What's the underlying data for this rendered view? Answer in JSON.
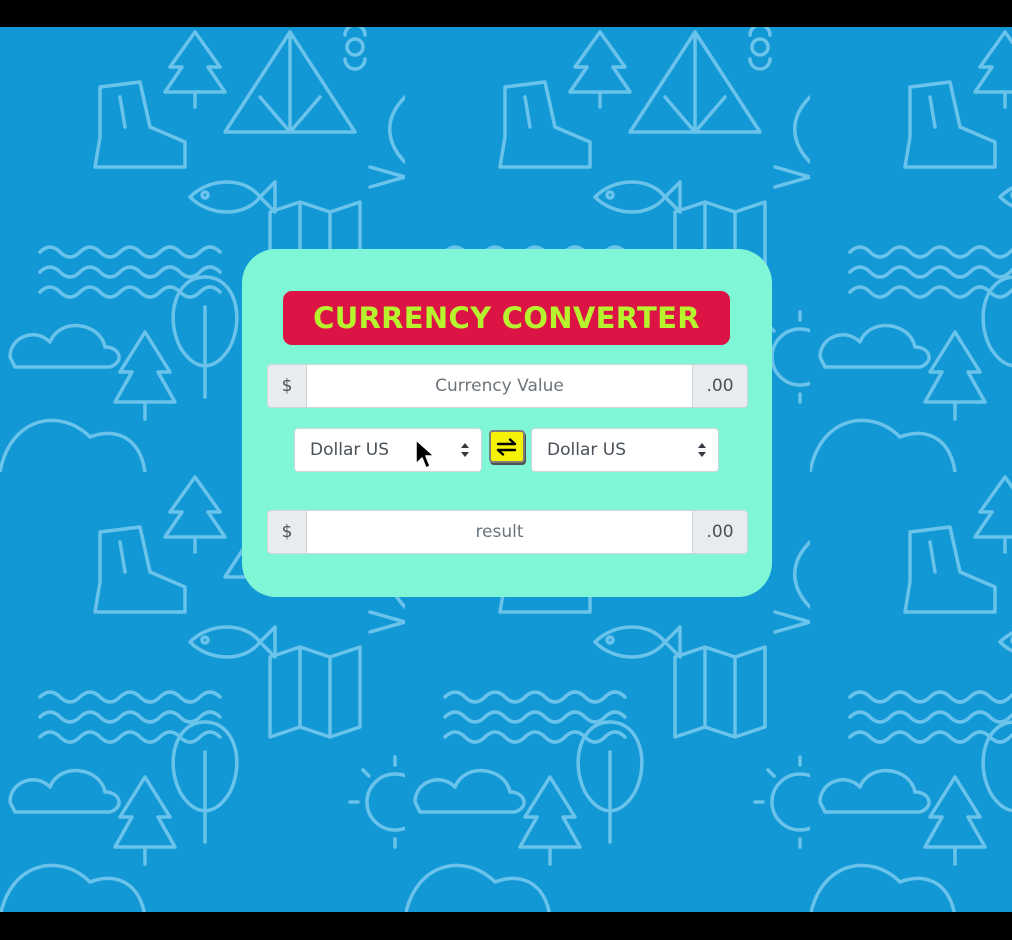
{
  "app": {
    "title": "CURRENCY CONVERTER"
  },
  "input_group": {
    "prefix": "$",
    "placeholder": "Currency Value",
    "suffix": ".00"
  },
  "from_select": {
    "value": "Dollar US"
  },
  "to_select": {
    "value": "Dollar US"
  },
  "swap_button": {
    "icon": "swap-arrows-icon"
  },
  "result_group": {
    "prefix": "$",
    "placeholder": "result",
    "suffix": ".00"
  },
  "colors": {
    "background": "#1398d6",
    "card": "#7ff7d6",
    "title_bg": "#dc1446",
    "title_text": "#b6f52e",
    "swap_button": "#f5f207"
  }
}
